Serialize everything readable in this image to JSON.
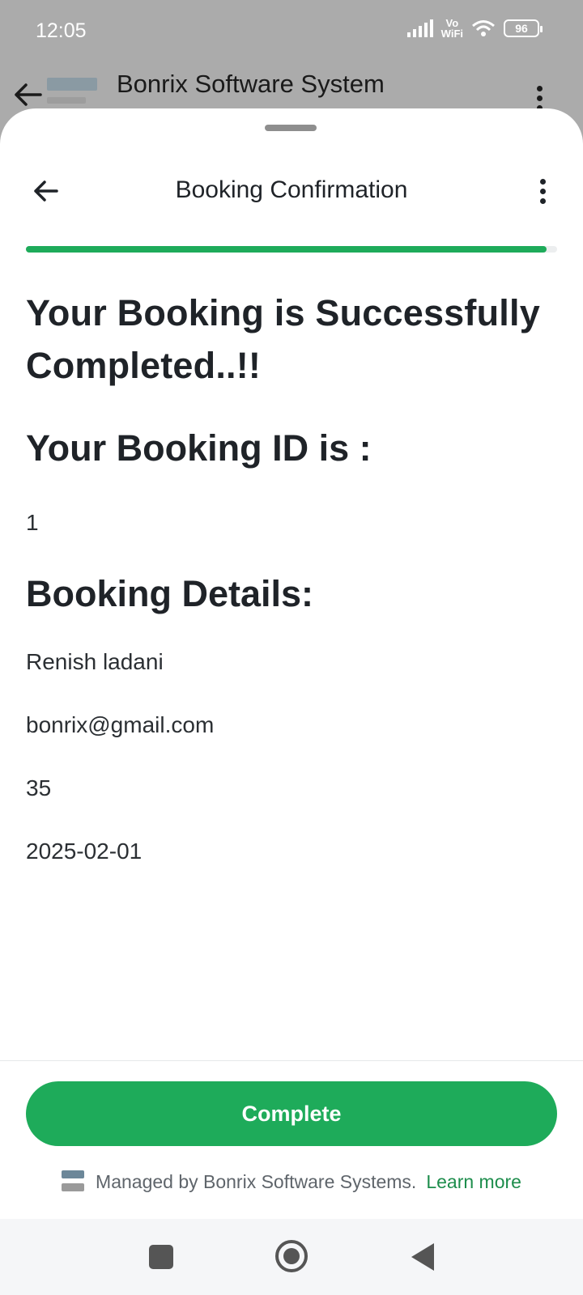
{
  "status_bar": {
    "time": "12:05",
    "vo_label": "Vo",
    "wifi_label": "WiFi",
    "battery": "96"
  },
  "background_app": {
    "title": "Bonrix Software System"
  },
  "sheet": {
    "title": "Booking Confirmation",
    "progress": 0.98,
    "success_heading": "Your Booking is Successfully Completed..!!",
    "booking_id_heading": "Your Booking ID is :",
    "booking_id": "1",
    "details_heading": "Booking Details:",
    "details": {
      "name": "Renish ladani",
      "email": "bonrix@gmail.com",
      "age": "35",
      "date": "2025-02-01"
    },
    "complete_label": "Complete",
    "managed_text": "Managed by Bonrix Software Systems.",
    "learn_more": "Learn more"
  },
  "colors": {
    "accent": "#1eab5a",
    "link": "#1d8d4c",
    "text": "#1f2328"
  }
}
